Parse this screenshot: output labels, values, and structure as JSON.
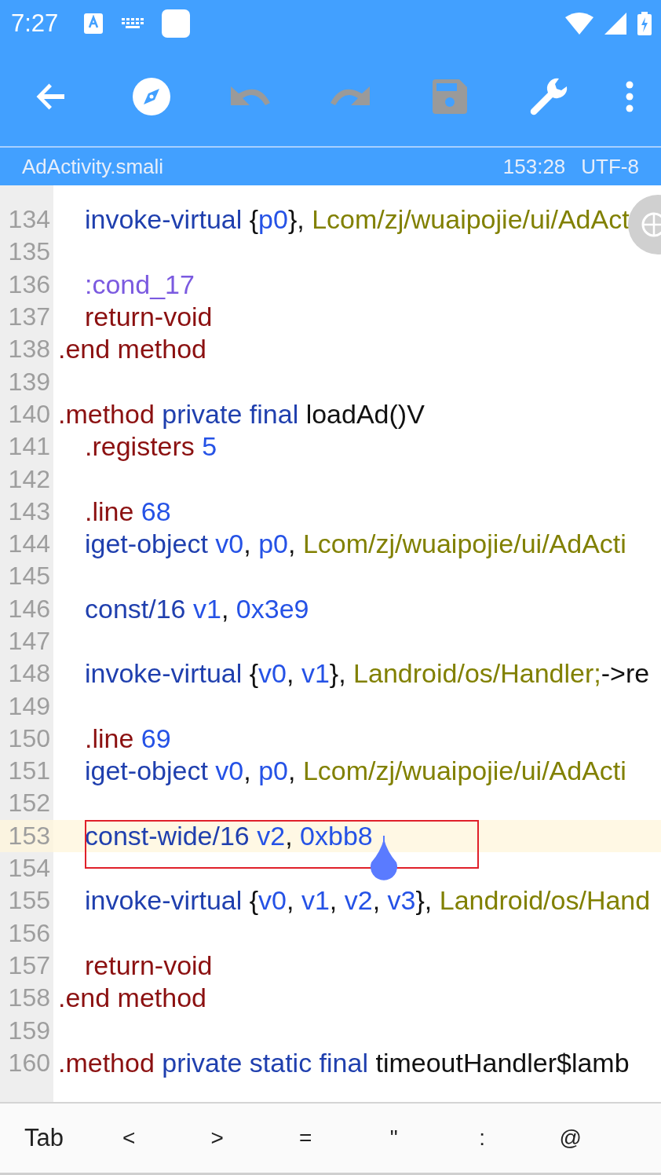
{
  "status_bar": {
    "time": "7:27"
  },
  "toolbar": {
    "actions": [
      {
        "kind": "back",
        "disabled": false
      },
      {
        "kind": "compass",
        "disabled": false
      },
      {
        "kind": "undo",
        "disabled": true
      },
      {
        "kind": "redo",
        "disabled": true
      },
      {
        "kind": "save",
        "disabled": true
      },
      {
        "kind": "tools",
        "disabled": false
      },
      {
        "kind": "more",
        "disabled": false
      }
    ]
  },
  "file_bar": {
    "file_name": "AdActivity.smali",
    "position": "153:28",
    "encoding": "UTF-8"
  },
  "editor": {
    "lines": [
      {
        "number": "134",
        "indented": true,
        "current": false,
        "tokens": [
          {
            "kind": "op",
            "text": "invoke-virtual "
          },
          {
            "kind": "plain",
            "text": "{"
          },
          {
            "kind": "number",
            "text": "p0"
          },
          {
            "kind": "plain",
            "text": "}, "
          },
          {
            "kind": "type",
            "text": "Lcom/zj/wuaipojie/ui/AdAct"
          }
        ]
      },
      {
        "number": "135",
        "current": false
      },
      {
        "number": "136",
        "indented": true,
        "current": false,
        "tokens": [
          {
            "kind": "label",
            "text": ":cond_17"
          }
        ]
      },
      {
        "number": "137",
        "indented": true,
        "current": false,
        "tokens": [
          {
            "kind": "keyword",
            "text": "return-void"
          }
        ]
      },
      {
        "number": "138",
        "indented": false,
        "current": false,
        "tokens": [
          {
            "kind": "keyword",
            "text": ".end method"
          }
        ]
      },
      {
        "number": "139",
        "current": false
      },
      {
        "number": "140",
        "indented": false,
        "current": false,
        "tokens": [
          {
            "kind": "keyword",
            "text": ".method "
          },
          {
            "kind": "op",
            "text": "private final "
          },
          {
            "kind": "plain",
            "text": "loadAd()V"
          }
        ]
      },
      {
        "number": "141",
        "indented": true,
        "current": false,
        "tokens": [
          {
            "kind": "keyword",
            "text": ".registers "
          },
          {
            "kind": "number",
            "text": "5"
          }
        ]
      },
      {
        "number": "142",
        "current": false
      },
      {
        "number": "143",
        "indented": true,
        "current": false,
        "tokens": [
          {
            "kind": "keyword",
            "text": ".line "
          },
          {
            "kind": "number",
            "text": "68"
          }
        ]
      },
      {
        "number": "144",
        "indented": true,
        "current": false,
        "tokens": [
          {
            "kind": "op",
            "text": "iget-object "
          },
          {
            "kind": "number",
            "text": "v0"
          },
          {
            "kind": "plain",
            "text": ", "
          },
          {
            "kind": "number",
            "text": "p0"
          },
          {
            "kind": "plain",
            "text": ", "
          },
          {
            "kind": "type",
            "text": "Lcom/zj/wuaipojie/ui/AdActi"
          }
        ]
      },
      {
        "number": "145",
        "current": false
      },
      {
        "number": "146",
        "indented": true,
        "current": false,
        "tokens": [
          {
            "kind": "op",
            "text": "const/16 "
          },
          {
            "kind": "number",
            "text": "v1"
          },
          {
            "kind": "plain",
            "text": ", "
          },
          {
            "kind": "number",
            "text": "0x3e9"
          }
        ]
      },
      {
        "number": "147",
        "current": false
      },
      {
        "number": "148",
        "indented": true,
        "current": false,
        "tokens": [
          {
            "kind": "op",
            "text": "invoke-virtual "
          },
          {
            "kind": "plain",
            "text": "{"
          },
          {
            "kind": "number",
            "text": "v0"
          },
          {
            "kind": "plain",
            "text": ", "
          },
          {
            "kind": "number",
            "text": "v1"
          },
          {
            "kind": "plain",
            "text": "}, "
          },
          {
            "kind": "type",
            "text": "Landroid/os/Handler;"
          },
          {
            "kind": "plain",
            "text": "->re"
          }
        ]
      },
      {
        "number": "149",
        "current": false
      },
      {
        "number": "150",
        "indented": true,
        "current": false,
        "tokens": [
          {
            "kind": "keyword",
            "text": ".line "
          },
          {
            "kind": "number",
            "text": "69"
          }
        ]
      },
      {
        "number": "151",
        "indented": true,
        "current": false,
        "tokens": [
          {
            "kind": "op",
            "text": "iget-object "
          },
          {
            "kind": "number",
            "text": "v0"
          },
          {
            "kind": "plain",
            "text": ", "
          },
          {
            "kind": "number",
            "text": "p0"
          },
          {
            "kind": "plain",
            "text": ", "
          },
          {
            "kind": "type",
            "text": "Lcom/zj/wuaipojie/ui/AdActi"
          }
        ]
      },
      {
        "number": "152",
        "current": false
      },
      {
        "number": "153",
        "indented": true,
        "current": true,
        "marked": true,
        "tokens": [
          {
            "kind": "op",
            "text": "const-wide/16 "
          },
          {
            "kind": "number",
            "text": "v2"
          },
          {
            "kind": "plain",
            "text": ", "
          },
          {
            "kind": "number",
            "text": "0xbb8"
          }
        ]
      },
      {
        "number": "154",
        "current": false
      },
      {
        "number": "155",
        "indented": true,
        "current": false,
        "tokens": [
          {
            "kind": "op",
            "text": "invoke-virtual "
          },
          {
            "kind": "plain",
            "text": "{"
          },
          {
            "kind": "number",
            "text": "v0"
          },
          {
            "kind": "plain",
            "text": ", "
          },
          {
            "kind": "number",
            "text": "v1"
          },
          {
            "kind": "plain",
            "text": ", "
          },
          {
            "kind": "number",
            "text": "v2"
          },
          {
            "kind": "plain",
            "text": ", "
          },
          {
            "kind": "number",
            "text": "v3"
          },
          {
            "kind": "plain",
            "text": "}, "
          },
          {
            "kind": "type",
            "text": "Landroid/os/Hand"
          }
        ]
      },
      {
        "number": "156",
        "current": false
      },
      {
        "number": "157",
        "indented": true,
        "current": false,
        "tokens": [
          {
            "kind": "keyword",
            "text": "return-void"
          }
        ]
      },
      {
        "number": "158",
        "indented": false,
        "current": false,
        "tokens": [
          {
            "kind": "keyword",
            "text": ".end method"
          }
        ]
      },
      {
        "number": "159",
        "current": false
      },
      {
        "number": "160",
        "indented": false,
        "current": false,
        "tokens": [
          {
            "kind": "keyword",
            "text": ".method "
          },
          {
            "kind": "op",
            "text": "private static final "
          },
          {
            "kind": "plain",
            "text": "timeoutHandler$lamb"
          }
        ]
      }
    ]
  },
  "extra_keys": [
    "Tab",
    "<",
    ">",
    "=",
    "\"",
    ":",
    "@"
  ]
}
